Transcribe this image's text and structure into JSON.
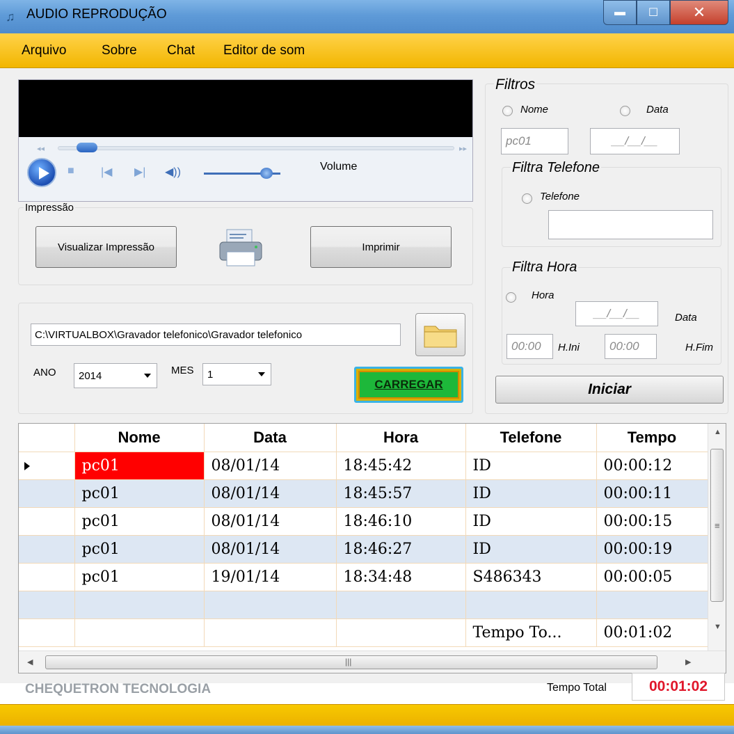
{
  "window": {
    "title": "AUDIO REPRODUÇÃO"
  },
  "menu": {
    "items": [
      "Arquivo",
      "Sobre",
      "Chat",
      "Editor de som"
    ]
  },
  "player": {
    "volume_label": "Volume",
    "position": 0.05,
    "volume": 0.82
  },
  "impressao": {
    "group_label": "Impressão",
    "preview_button": "Visualizar Impressão",
    "print_button": "Imprimir"
  },
  "loader": {
    "path": "C:\\VIRTUALBOX\\Gravador telefonico\\Gravador telefonico",
    "ano_label": "ANO",
    "ano_value": "2014",
    "mes_label": "MES",
    "mes_value": "1",
    "load_button": "CARREGAR"
  },
  "filtros": {
    "title": "Filtros",
    "nome_label": "Nome",
    "data_label": "Data",
    "nome_value": "pc01",
    "data_mask": "__/__/__",
    "telefone_group": "Filtra Telefone",
    "telefone_label": "Telefone",
    "telefone_value": "",
    "hora_group": "Filtra Hora",
    "hora_label": "Hora",
    "hora_data_mask": "__/__/__",
    "hora_data_label": "Data",
    "hini_mask": "00:00",
    "hini_label": "H.Ini",
    "hfim_mask": "00:00",
    "hfim_label": "H.Fim",
    "iniciar_button": "Iniciar"
  },
  "grid": {
    "columns": [
      "Nome",
      "Data",
      "Hora",
      "Telefone",
      "Tempo"
    ],
    "rows": [
      [
        "pc01",
        "08/01/14",
        "18:45:42",
        "ID",
        "00:00:12"
      ],
      [
        "pc01",
        "08/01/14",
        "18:45:57",
        "ID",
        "00:00:11"
      ],
      [
        "pc01",
        "08/01/14",
        "18:46:10",
        "ID",
        "00:00:15"
      ],
      [
        "pc01",
        "08/01/14",
        "18:46:27",
        "ID",
        "00:00:19"
      ],
      [
        "pc01",
        "19/01/14",
        "18:34:48",
        "S486343",
        "00:00:05"
      ],
      [
        "",
        "",
        "",
        "",
        ""
      ],
      [
        "",
        "",
        "",
        "Tempo To...",
        "00:01:02"
      ]
    ]
  },
  "status": {
    "company": "CHEQUETRON TECNOLOGIA",
    "tempo_total_label": "Tempo Total",
    "tempo_total_value": "00:01:02"
  },
  "colors": {
    "menu_bar": "#f2b600",
    "selected_cell": "#ff0000",
    "alt_row": "#dde7f3",
    "total_value": "#e0162a"
  }
}
